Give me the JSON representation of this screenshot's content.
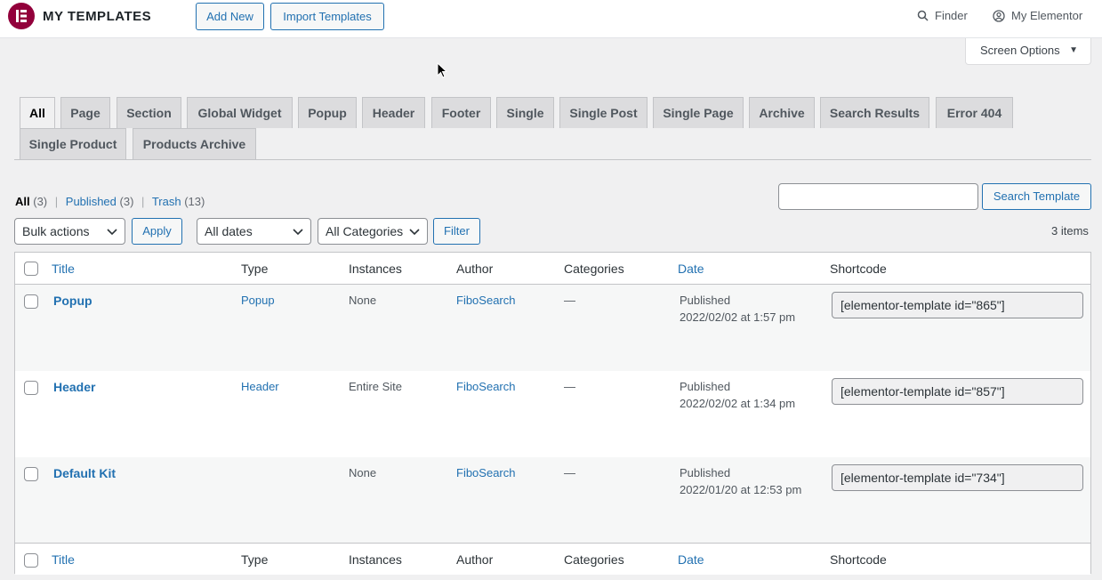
{
  "header": {
    "app_title": "MY TEMPLATES",
    "add_new": "Add New",
    "import_templates": "Import Templates",
    "finder": "Finder",
    "my_elementor": "My Elementor"
  },
  "screen_options": "Screen Options",
  "tabs": [
    "All",
    "Page",
    "Section",
    "Global Widget",
    "Popup",
    "Header",
    "Footer",
    "Single",
    "Single Post",
    "Single Page",
    "Archive",
    "Search Results",
    "Error 404",
    "Single Product",
    "Products Archive"
  ],
  "views": {
    "all_label": "All",
    "all_count": "(3)",
    "published_label": "Published",
    "published_count": "(3)",
    "trash_label": "Trash",
    "trash_count": "(13)",
    "separator": "|"
  },
  "search": {
    "placeholder": "",
    "button": "Search Template"
  },
  "filters": {
    "bulk_actions": "Bulk actions",
    "apply": "Apply",
    "dates": "All dates",
    "categories": "All Categories",
    "filter": "Filter",
    "items_count": "3 items"
  },
  "table": {
    "columns": [
      "Title",
      "Type",
      "Instances",
      "Author",
      "Categories",
      "Date",
      "Shortcode"
    ],
    "rows": [
      {
        "title": "Popup",
        "type": "Popup",
        "instances": "None",
        "author": "FiboSearch",
        "categories": "—",
        "status": "Published",
        "date": "2022/02/02 at 1:57 pm",
        "shortcode": "[elementor-template id=\"865\"]"
      },
      {
        "title": "Header",
        "type": "Header",
        "instances": "Entire Site",
        "author": "FiboSearch",
        "categories": "—",
        "status": "Published",
        "date": "2022/02/02 at 1:34 pm",
        "shortcode": "[elementor-template id=\"857\"]"
      },
      {
        "title": "Default Kit",
        "type": "",
        "instances": "None",
        "author": "FiboSearch",
        "categories": "—",
        "status": "Published",
        "date": "2022/01/20 at 12:53 pm",
        "shortcode": "[elementor-template id=\"734\"]"
      }
    ]
  },
  "colors": {
    "accent": "#2271b1",
    "logo": "#92003b"
  }
}
